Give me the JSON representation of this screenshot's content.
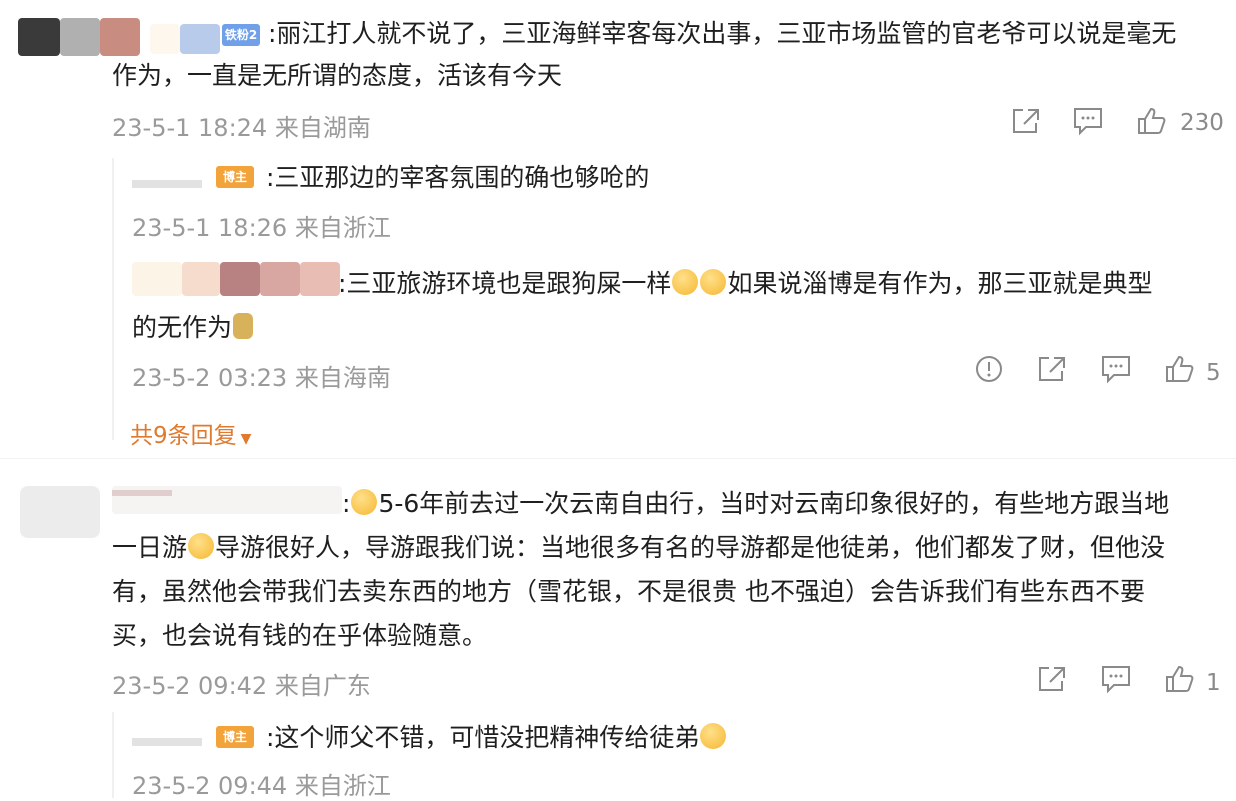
{
  "comments": [
    {
      "text_line1": ":丽江打人就不说了，三亚海鲜宰客每次出事，三亚市场监管的官老爷可以说是毫无",
      "text_line2": "作为，一直是无所谓的态度，活该有今天",
      "time": "23-5-1 18:24 来自湖南",
      "likes": "230",
      "badge": "铁粉2"
    },
    {
      "text": ":三亚那边的宰客氛围的确也够呛的",
      "time": "23-5-1 18:26 来自浙江",
      "badge": "博主"
    },
    {
      "text_line1_a": ":三亚旅游环境也是跟狗屎一样",
      "text_line1_b": "如果说淄博是有作为，那三亚就是典型",
      "text_line2": "的无作为",
      "time": "23-5-2 03:23 来自海南",
      "likes": "5",
      "more": "共9条回复"
    },
    {
      "text_line1": "5-6年前去过一次云南自由行，当时对云南印象很好的，有些地方跟当地",
      "text_line2_a": "一日游",
      "text_line2_b": "导游很好人，导游跟我们说：当地很多有名的导游都是他徒弟，他们都发了财，但他没",
      "text_line3": "有，虽然他会带我们去卖东西的地方（雪花银，不是很贵 也不强迫）会告诉我们有些东西不要",
      "text_line4": "买，也会说有钱的在乎体验随意。",
      "time": "23-5-2 09:42 来自广东",
      "likes": "1"
    },
    {
      "text": ":这个师父不错，可惜没把精神传给徒弟",
      "time": "23-5-2 09:44 来自浙江",
      "badge": "博主"
    }
  ],
  "colors": {
    "meta": "#9a9a9a",
    "more": "#e07a2f",
    "badge_orange": "#f2a33a",
    "badge_blue": "#6fa0e8"
  }
}
